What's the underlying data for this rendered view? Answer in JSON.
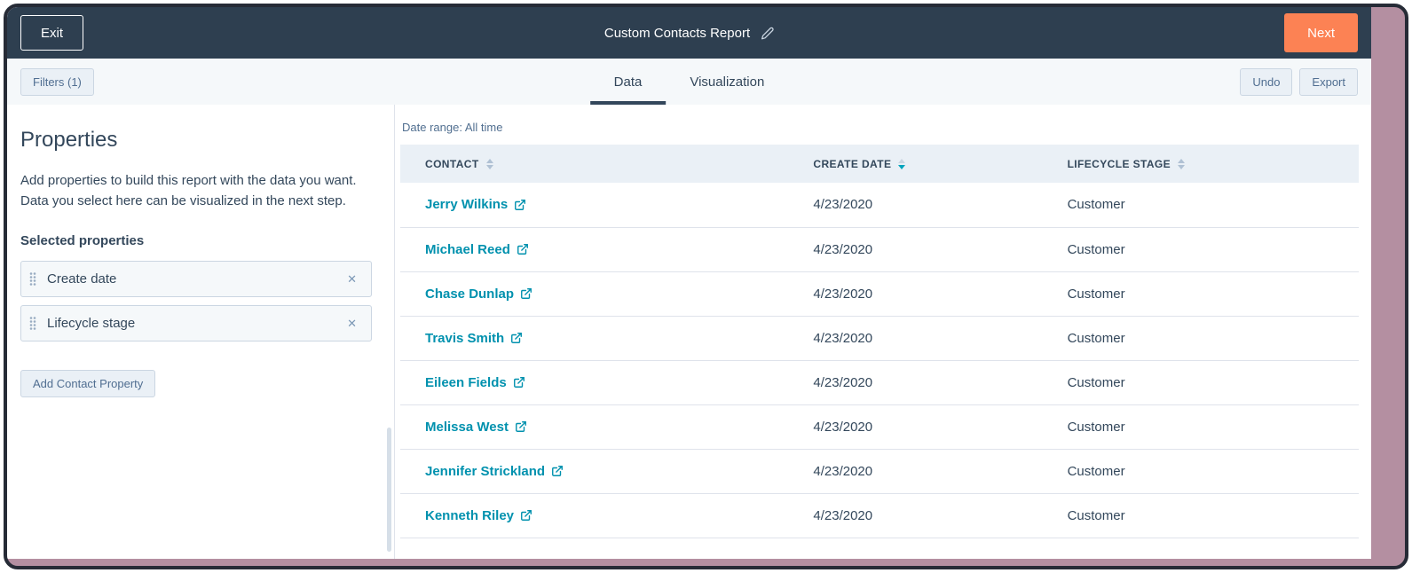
{
  "colors": {
    "topbar_bg": "#2e3f50",
    "primary_button": "#fc8254",
    "link": "#0091ae",
    "active_sort": "#00a4bd",
    "toolbar_bg": "#f5f8fa",
    "table_header_bg": "#eaf0f6",
    "frame_accent": "#b48fa1",
    "text": "#33475b"
  },
  "topbar": {
    "exit_label": "Exit",
    "title": "Custom Contacts Report",
    "next_label": "Next"
  },
  "toolbar": {
    "filters_label": "Filters (1)",
    "tabs": [
      {
        "label": "Data",
        "active": true
      },
      {
        "label": "Visualization",
        "active": false
      }
    ],
    "undo_label": "Undo",
    "export_label": "Export"
  },
  "sidebar": {
    "title": "Properties",
    "description": "Add properties to build this report with the data you want. Data you select here can be visualized in the next step.",
    "selected_heading": "Selected properties",
    "selected_properties": [
      {
        "label": "Create date"
      },
      {
        "label": "Lifecycle stage"
      }
    ],
    "remove_icon": "✕",
    "add_button_label": "Add Contact Property"
  },
  "report": {
    "date_range_label": "Date range: All time",
    "table": {
      "columns": [
        {
          "label": "CONTACT",
          "sort": "none"
        },
        {
          "label": "CREATE DATE",
          "sort": "desc"
        },
        {
          "label": "LIFECYCLE STAGE",
          "sort": "none"
        }
      ],
      "rows": [
        {
          "contact": "Jerry Wilkins",
          "create_date": "4/23/2020",
          "lifecycle_stage": "Customer"
        },
        {
          "contact": "Michael Reed",
          "create_date": "4/23/2020",
          "lifecycle_stage": "Customer"
        },
        {
          "contact": "Chase Dunlap",
          "create_date": "4/23/2020",
          "lifecycle_stage": "Customer"
        },
        {
          "contact": "Travis Smith",
          "create_date": "4/23/2020",
          "lifecycle_stage": "Customer"
        },
        {
          "contact": "Eileen Fields",
          "create_date": "4/23/2020",
          "lifecycle_stage": "Customer"
        },
        {
          "contact": "Melissa West",
          "create_date": "4/23/2020",
          "lifecycle_stage": "Customer"
        },
        {
          "contact": "Jennifer Strickland",
          "create_date": "4/23/2020",
          "lifecycle_stage": "Customer"
        },
        {
          "contact": "Kenneth Riley",
          "create_date": "4/23/2020",
          "lifecycle_stage": "Customer"
        }
      ]
    }
  }
}
